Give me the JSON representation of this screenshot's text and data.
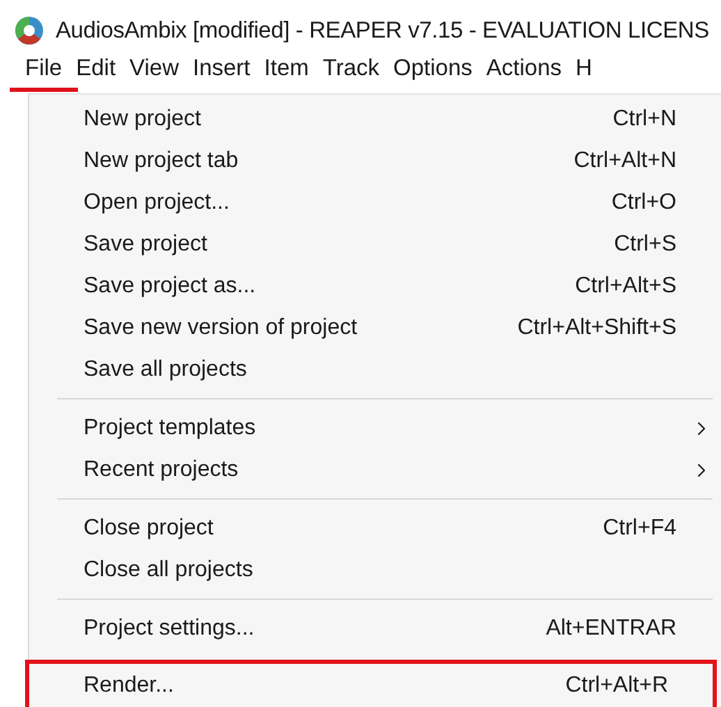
{
  "window": {
    "title": "AudiosAmbix [modified] - REAPER v7.15 - EVALUATION LICENS"
  },
  "menu_bar": [
    {
      "label": "File",
      "selected": true
    },
    {
      "label": "Edit",
      "selected": false
    },
    {
      "label": "View",
      "selected": false
    },
    {
      "label": "Insert",
      "selected": false
    },
    {
      "label": "Item",
      "selected": false
    },
    {
      "label": "Track",
      "selected": false
    },
    {
      "label": "Options",
      "selected": false
    },
    {
      "label": "Actions",
      "selected": false
    },
    {
      "label": "H",
      "selected": false
    }
  ],
  "menu": {
    "groups": [
      {
        "items": [
          {
            "label": "New project",
            "shortcut": "Ctrl+N",
            "submenu": false,
            "highlighted": false
          },
          {
            "label": "New project tab",
            "shortcut": "Ctrl+Alt+N",
            "submenu": false,
            "highlighted": false
          },
          {
            "label": "Open project...",
            "shortcut": "Ctrl+O",
            "submenu": false,
            "highlighted": false
          },
          {
            "label": "Save project",
            "shortcut": "Ctrl+S",
            "submenu": false,
            "highlighted": false
          },
          {
            "label": "Save project as...",
            "shortcut": "Ctrl+Alt+S",
            "submenu": false,
            "highlighted": false
          },
          {
            "label": "Save new version of project",
            "shortcut": "Ctrl+Alt+Shift+S",
            "submenu": false,
            "highlighted": false
          },
          {
            "label": "Save all projects",
            "submenu": false,
            "highlighted": false
          }
        ]
      },
      {
        "items": [
          {
            "label": "Project templates",
            "submenu": true,
            "highlighted": false
          },
          {
            "label": "Recent projects",
            "submenu": true,
            "highlighted": false
          }
        ]
      },
      {
        "items": [
          {
            "label": "Close project",
            "shortcut": "Ctrl+F4",
            "submenu": false,
            "highlighted": false
          },
          {
            "label": "Close all projects",
            "submenu": false,
            "highlighted": false
          }
        ]
      },
      {
        "items": [
          {
            "label": "Project settings...",
            "shortcut": "Alt+ENTRAR",
            "submenu": false,
            "highlighted": false
          },
          {
            "label": "Render...",
            "shortcut": "Ctrl+Alt+R",
            "submenu": false,
            "highlighted": true
          }
        ]
      }
    ]
  }
}
